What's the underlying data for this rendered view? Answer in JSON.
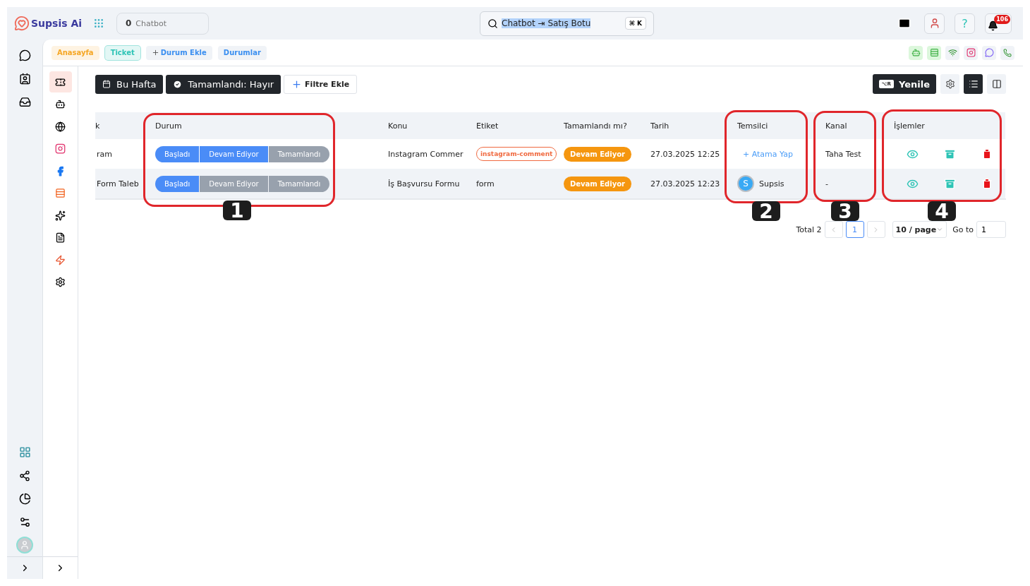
{
  "brand": {
    "name": "Supsis Ai"
  },
  "chatbot_counter": {
    "count": "0",
    "label": "Chatbot"
  },
  "search": {
    "value": "Chatbot ⇥ Satış Botu",
    "selected": true,
    "shortcut": "⌘ K"
  },
  "help": {
    "glyph": "?"
  },
  "notifications": {
    "count": "106"
  },
  "tabs": [
    {
      "label": "Anasayfa",
      "kind": "pill",
      "color": "#f5a623",
      "selected": false
    },
    {
      "label": "Ticket",
      "kind": "pill",
      "color": "#2ec4b6",
      "selected": true
    },
    {
      "label": "Durum Ekle",
      "kind": "add",
      "selected": false
    },
    {
      "label": "Durumlar",
      "kind": "plain",
      "selected": false
    }
  ],
  "sidebar": {
    "items": [
      {
        "selected": true
      },
      {
        "selected": false
      },
      {
        "selected": false
      },
      {
        "selected": false
      },
      {
        "selected": false
      },
      {
        "selected": false
      },
      {
        "selected": false
      },
      {
        "selected": false
      },
      {
        "selected": false
      },
      {
        "selected": false
      }
    ]
  },
  "filters": [
    {
      "label": "Bu Hafta",
      "kind": "date"
    },
    {
      "label": "Tamamlandı: Hayır",
      "kind": "check"
    },
    {
      "label": "Filtre Ekle",
      "kind": "add"
    }
  ],
  "refresh": {
    "label": "Yenile",
    "shortcut": "⌥R"
  },
  "view_modes": [
    {
      "selected": true
    },
    {
      "selected": false
    }
  ],
  "table": {
    "columns": [
      "k",
      "Durum",
      "Konu",
      "Etiket",
      "Tamamlandı mı?",
      "Tarih",
      "Temsilci",
      "Kanal",
      "İşlemler"
    ],
    "rows": [
      {
        "column_1": "ram",
        "status": [
          {
            "label": "Başladı",
            "on": true
          },
          {
            "label": "Devam Ediyor",
            "on": true
          },
          {
            "label": "Tamamlandı",
            "on": false
          }
        ],
        "konu": "Instagram Commer",
        "etiket": {
          "kind": "tag",
          "text": "instagram-comment"
        },
        "completed": "Devam Ediyor",
        "tarih": "27.03.2025 12:25",
        "temsilci": {
          "kind": "assign",
          "text": "+ Atama Yap"
        },
        "kanal": "Taha Test"
      },
      {
        "column_1": "Form Taleb",
        "status": [
          {
            "label": "Başladı",
            "on": true
          },
          {
            "label": "Devam Ediyor",
            "on": false
          },
          {
            "label": "Tamamlandı",
            "on": false
          }
        ],
        "konu": "İş Başvursu Formu",
        "etiket": {
          "kind": "text",
          "text": "form"
        },
        "completed": "Devam Ediyor",
        "tarih": "27.03.2025 12:23",
        "temsilci": {
          "kind": "agent",
          "initial": "S",
          "text": "Supsis"
        },
        "kanal": "-"
      }
    ]
  },
  "pagination": {
    "total": "Total 2",
    "pages": [
      {
        "label": "1",
        "selected": true
      }
    ],
    "page_size": "10 / page",
    "goto_label": "Go to",
    "goto_value": "1"
  },
  "annotations": [
    "1",
    "2",
    "3",
    "4"
  ]
}
